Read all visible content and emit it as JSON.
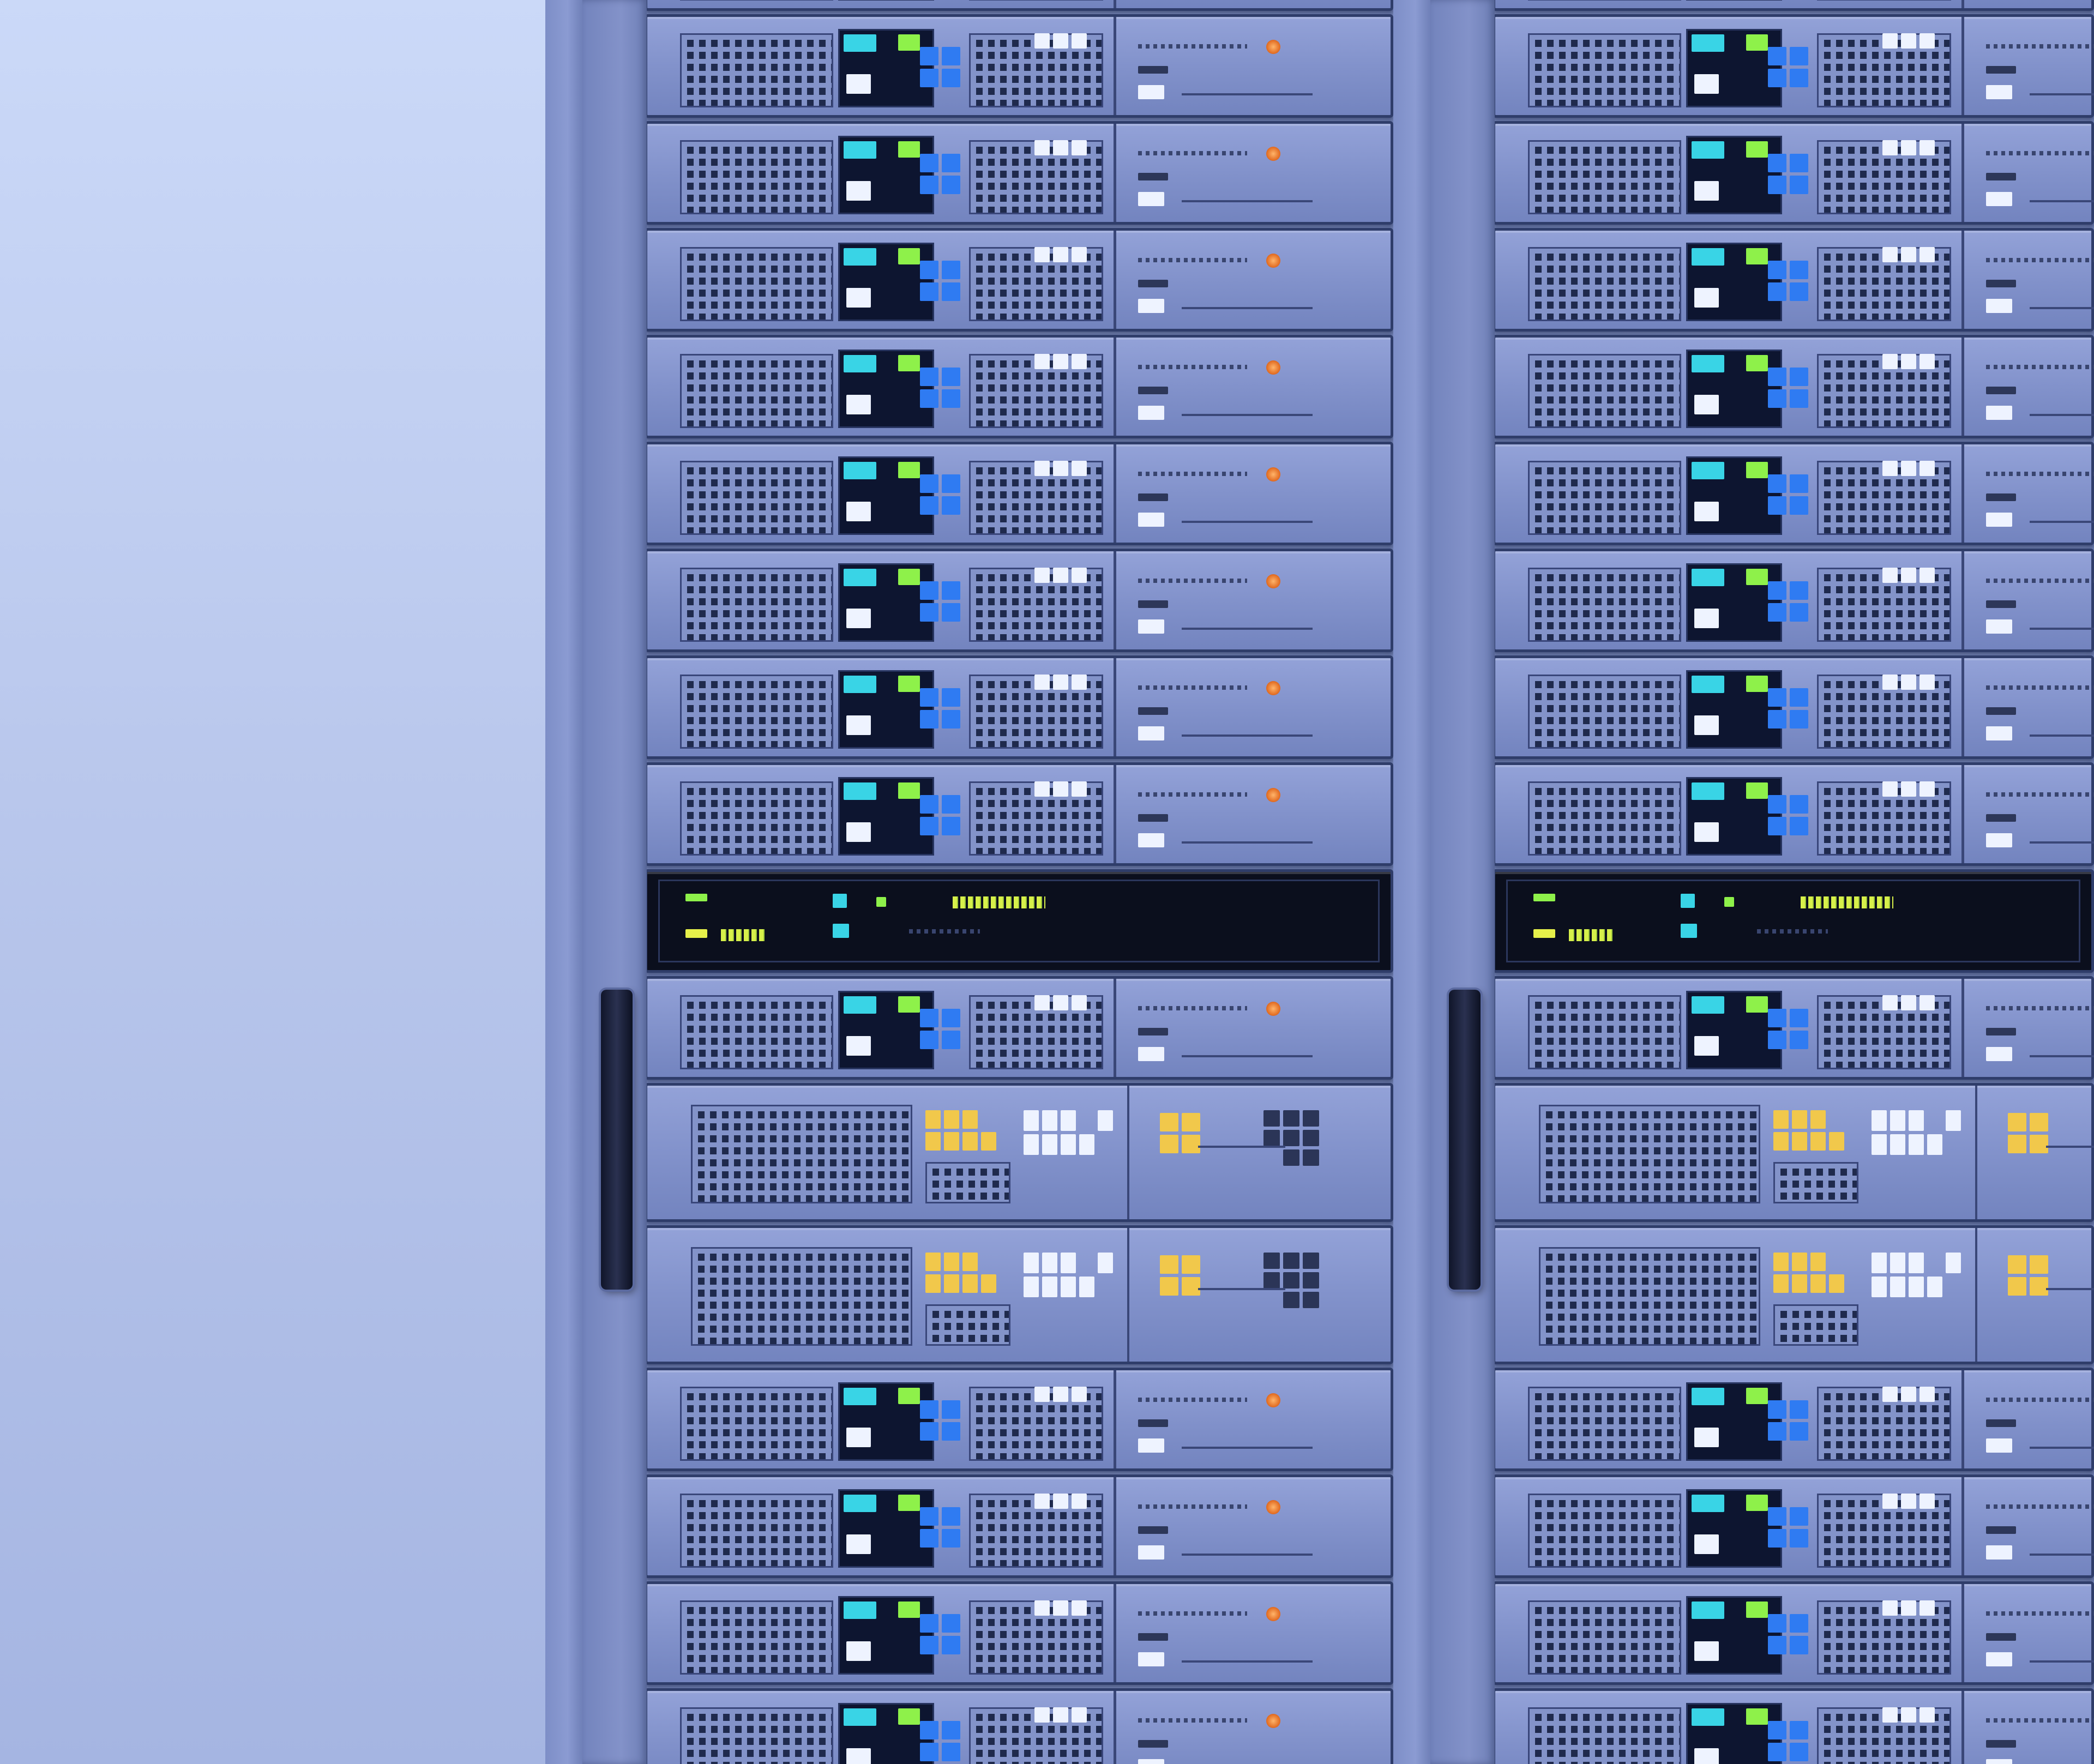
{
  "scene": {
    "subject": "server-racks",
    "background": "#c7d6f6",
    "colors": {
      "rack_frame": "#8d9dcf",
      "unit_face": "#8292cb",
      "grille_hole": "#1f2a4d",
      "led_blue": "#2f7bf2",
      "led_cyan": "#39d4e6",
      "led_green": "#8ef14a",
      "led_white": "#eef3ff",
      "led_orange": "#f08a33",
      "led_yellow": "#f1c84b",
      "console_dark": "#0b0f1d"
    },
    "racks": [
      {
        "name": "left-rack",
        "handle": true
      },
      {
        "name": "right-rack",
        "handle": true
      }
    ],
    "unit_sequence": [
      "server-1u",
      "server-1u",
      "server-1u",
      "server-1u",
      "server-1u",
      "server-1u",
      "server-1u",
      "server-1u",
      "server-1u",
      "console-1u",
      "server-1u",
      "storage-2u",
      "storage-2u",
      "server-1u",
      "server-1u",
      "server-1u",
      "server-1u"
    ]
  }
}
